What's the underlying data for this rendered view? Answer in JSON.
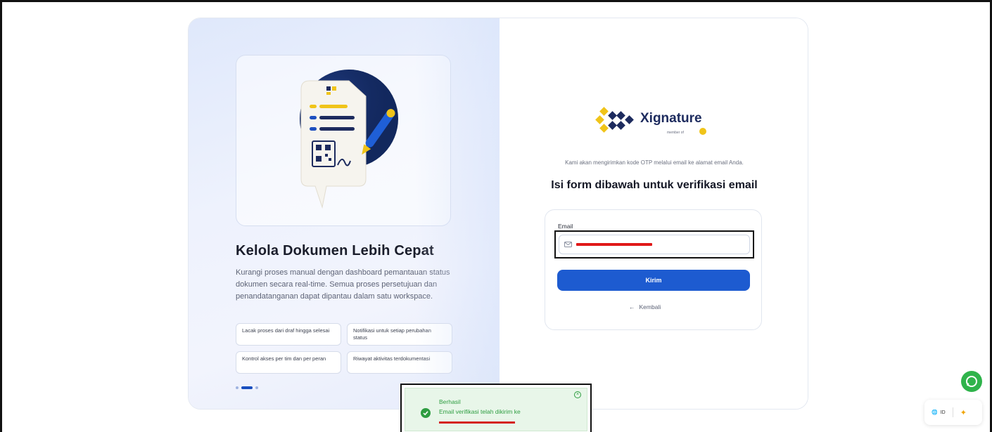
{
  "hero": {
    "headline": "Kelola Dokumen Lebih Cepat",
    "description": "Kurangi proses manual dengan dashboard pemantauan status dokumen secara real-time. Semua proses persetujuan dan penandatanganan dapat dipantau dalam satu workspace.",
    "features": [
      "Lacak proses dari draf hingga selesai",
      "Notifikasi untuk setiap perubahan status",
      "Kontrol akses per tim dan per peran",
      "Riwayat aktivitas terdokumentasi"
    ],
    "carousel_active_index": 1,
    "carousel_total": 3
  },
  "brand": {
    "name": "Xignature",
    "member": "member of"
  },
  "form": {
    "otp_note": "Kami akan mengirimkan kode OTP melalui email ke alamat email Anda.",
    "title": "Isi form dibawah untuk verifikasi email",
    "email_label": "Email",
    "submit_label": "Kirim",
    "back_label": "Kembali"
  },
  "toast": {
    "title": "Berhasil",
    "message": "Email verifikasi telah dikirim ke"
  },
  "floating": {
    "lang_code": "ID"
  },
  "colors": {
    "primary": "#1d5bd0",
    "brand_navy": "#1d2b5e",
    "brand_gold": "#f0c419",
    "success": "#2e9d41",
    "whatsapp": "#2fb34b"
  }
}
